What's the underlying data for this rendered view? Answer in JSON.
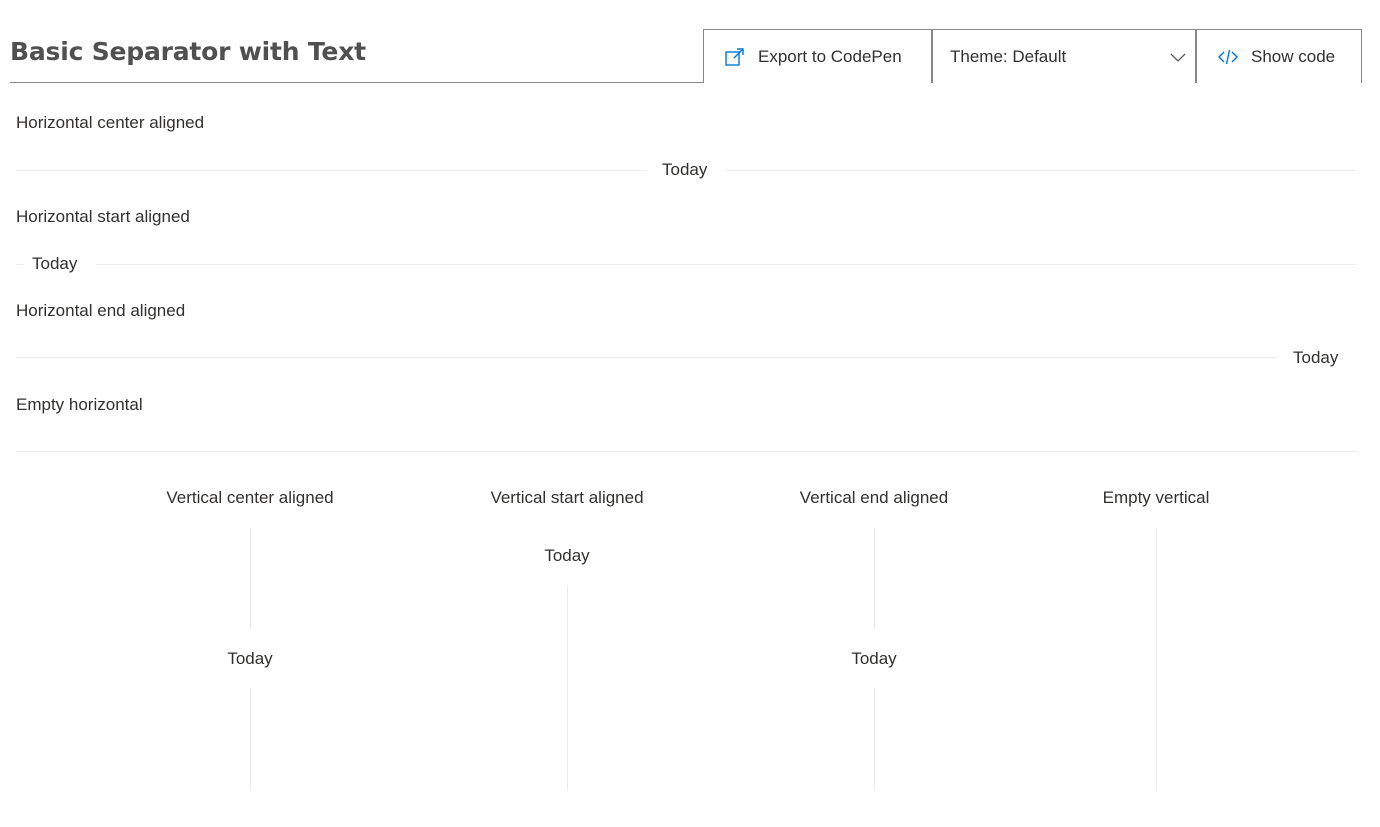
{
  "header": {
    "title": "Basic Separator with Text",
    "export_label": "Export to CodePen",
    "theme_label": "Theme: Default",
    "code_label": "Show code"
  },
  "horizontal": {
    "center_label": "Horizontal center aligned",
    "center_text": "Today",
    "start_label": "Horizontal start aligned",
    "start_text": "Today",
    "end_label": "Horizontal end aligned",
    "end_text": "Today",
    "empty_label": "Empty horizontal"
  },
  "vertical": {
    "center_label": "Vertical center aligned",
    "center_text": "Today",
    "start_label": "Vertical start aligned",
    "start_text": "Today",
    "end_label": "Vertical end aligned",
    "end_text": "Today",
    "empty_label": "Empty vertical"
  },
  "icons": {
    "export": "external-link-icon",
    "theme": "chevron-down-icon",
    "code": "code-icon"
  },
  "colors": {
    "accent": "#0078d4",
    "separator": "#edebe9",
    "text": "#323130"
  }
}
